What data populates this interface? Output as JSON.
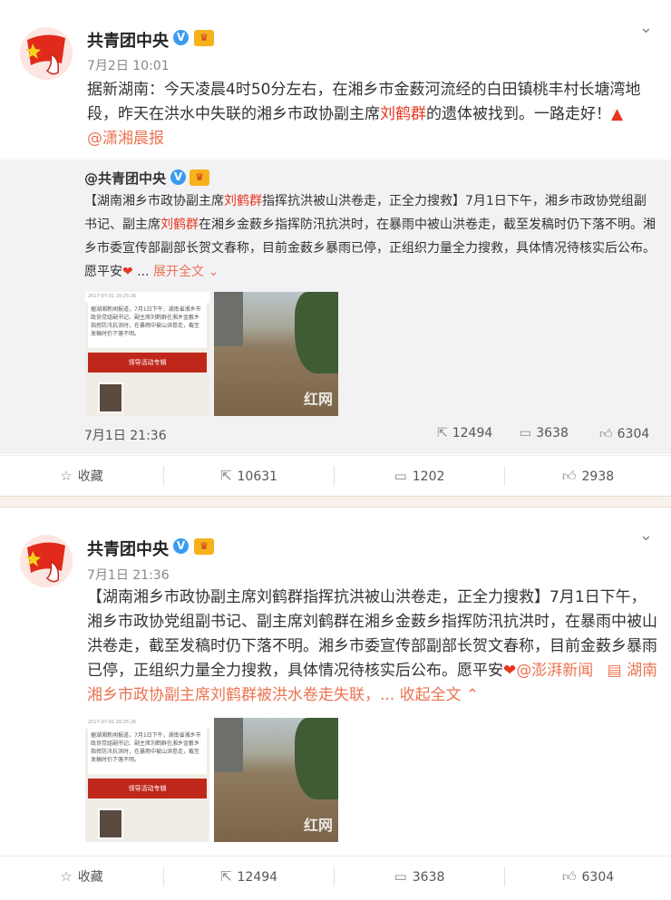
{
  "post1": {
    "author": "共青团中央",
    "time": "7月2日 10:01",
    "text_a": "据新湖南：今天凌晨4时50分左右，在湘乡市金薮河流经的白田镇桃丰村长塘湾地段，昨天在洪水中失联的湘乡市政协副主席",
    "text_name": "刘鹤群",
    "text_b": "的遗体被找到。一路走好！",
    "mention": "@潇湘晨报",
    "repost": {
      "author": "@共青团中央",
      "text_1": "【湖南湘乡市政协副主席",
      "name_1": "刘鹤群",
      "text_2": "指挥抗洪被山洪卷走，正全力搜救】7月1日下午，湘乡市政协党组副书记、副主席",
      "name_2": "刘鹤群",
      "text_3": "在湘乡金薮乡指挥防汛抗洪时，在暴雨中被山洪卷走，截至发稿时仍下落不明。湘乡市委宣传部副部长贺文春称，目前金薮乡暴雨已停，正组织力量全力搜救，具体情况待核实后公布。愿平安",
      "ellipsis": "...",
      "expand": "展开全文",
      "time": "7月1日 21:36",
      "reposts": "12494",
      "comments": "3638",
      "likes": "6304"
    },
    "actions": {
      "fav": "收藏",
      "reposts": "10631",
      "comments": "1202",
      "likes": "2938"
    }
  },
  "post2": {
    "author": "共青团中央",
    "time": "7月1日 21:36",
    "text": "【湖南湘乡市政协副主席刘鹤群指挥抗洪被山洪卷走，正全力搜救】7月1日下午，湘乡市政协党组副书记、副主席刘鹤群在湘乡金薮乡指挥防汛抗洪时，在暴雨中被山洪卷走，截至发稿时仍下落不明。湘乡市委宣传部副部长贺文春称，目前金薮乡暴雨已停，正组织力量全力搜救，具体情况待核实后公布。愿平安",
    "mention": "@澎湃新闻",
    "link": "湖南湘乡市政协副主席刘鹤群被洪水卷走失联，...",
    "collapse": "收起全文",
    "actions": {
      "fav": "收藏",
      "reposts": "12494",
      "comments": "3638",
      "likes": "6304"
    }
  },
  "doc_image": {
    "header": "2017-07-01 20:25:26",
    "body": "据湖湘新闻报道，7月1日下午，湖南省湘乡市政协党组副书记、副主席刘鹤群在湘乡金薮乡指挥防汛抗洪时，在暴雨中被山洪卷走，截至发稿时仍下落不明。",
    "banner": "领导活动专辑"
  },
  "photo_watermark": "红网"
}
